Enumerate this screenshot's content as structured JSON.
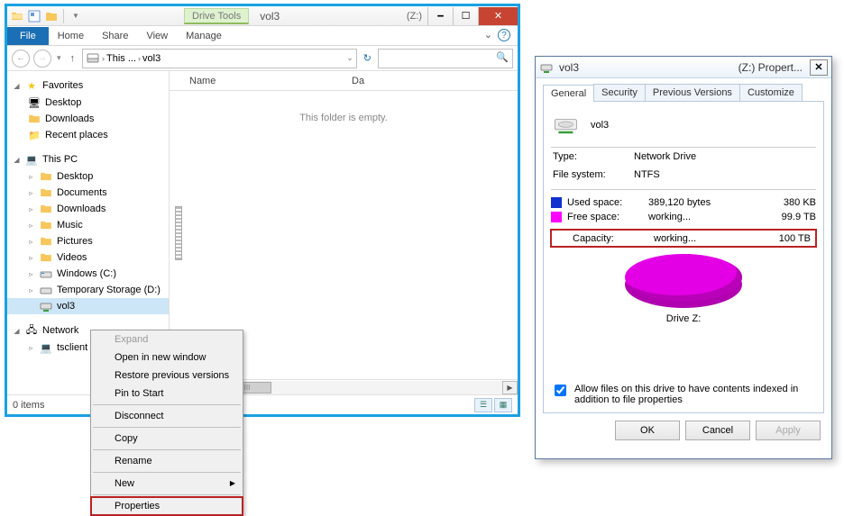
{
  "explorer": {
    "drive_tools_label": "Drive Tools",
    "window_title": "vol3",
    "drive_label": "(Z:)",
    "caption": {
      "min": "🗕",
      "max": "☐",
      "close": "✕"
    },
    "ribbon": {
      "file": "File",
      "tabs": [
        "Home",
        "Share",
        "View",
        "Manage"
      ],
      "chevron": "⌄",
      "help": "?"
    },
    "nav": {
      "back": "←",
      "fwd": "→",
      "dd": "▾",
      "up": "↑"
    },
    "address": {
      "crumb1": "This ...",
      "crumb2": "vol3",
      "sep": "›",
      "dd": "⌄",
      "refresh": "↻"
    },
    "search_placeholder": "",
    "tree": {
      "favorites": "Favorites",
      "fav_items": [
        "Desktop",
        "Downloads",
        "Recent places"
      ],
      "thispc": "This PC",
      "pc_items": [
        "Desktop",
        "Documents",
        "Downloads",
        "Music",
        "Pictures",
        "Videos",
        "Windows (C:)",
        "Temporary Storage (D:)",
        "vol3"
      ],
      "network": "Network",
      "net_items": [
        "tsclient"
      ]
    },
    "columns": {
      "name": "Name",
      "date": "Da"
    },
    "empty_msg": "This folder is empty.",
    "status": "0 items",
    "scroll_thumb": "III"
  },
  "ctx": {
    "items": [
      {
        "label": "Expand",
        "disabled": true
      },
      {
        "label": "Open in new window"
      },
      {
        "label": "Restore previous versions"
      },
      {
        "label": "Pin to Start"
      },
      {
        "sep": true
      },
      {
        "label": "Disconnect"
      },
      {
        "sep": true
      },
      {
        "label": "Copy"
      },
      {
        "sep": true
      },
      {
        "label": "Rename"
      },
      {
        "sep": true
      },
      {
        "label": "New",
        "submenu": true
      },
      {
        "sep": true
      },
      {
        "label": "Properties",
        "hl": true
      }
    ]
  },
  "props": {
    "title_left": "vol3",
    "title_right": "(Z:) Propert...",
    "close": "✕",
    "tabs": [
      "General",
      "Security",
      "Previous Versions",
      "Customize"
    ],
    "drive_name": "vol3",
    "type_label": "Type:",
    "type_value": "Network Drive",
    "fs_label": "File system:",
    "fs_value": "NTFS",
    "used_label": "Used space:",
    "used_bytes": "389,120 bytes",
    "used_h": "380 KB",
    "free_label": "Free space:",
    "free_bytes": "working...",
    "free_h": "99.9 TB",
    "cap_label": "Capacity:",
    "cap_bytes": "working...",
    "cap_h": "100 TB",
    "drive_letter": "Drive Z:",
    "index_label": "Allow files on this drive to have contents indexed in addition to file properties",
    "btn_ok": "OK",
    "btn_cancel": "Cancel",
    "btn_apply": "Apply",
    "used_color": "#1030d0",
    "free_color": "#ff00ff"
  }
}
